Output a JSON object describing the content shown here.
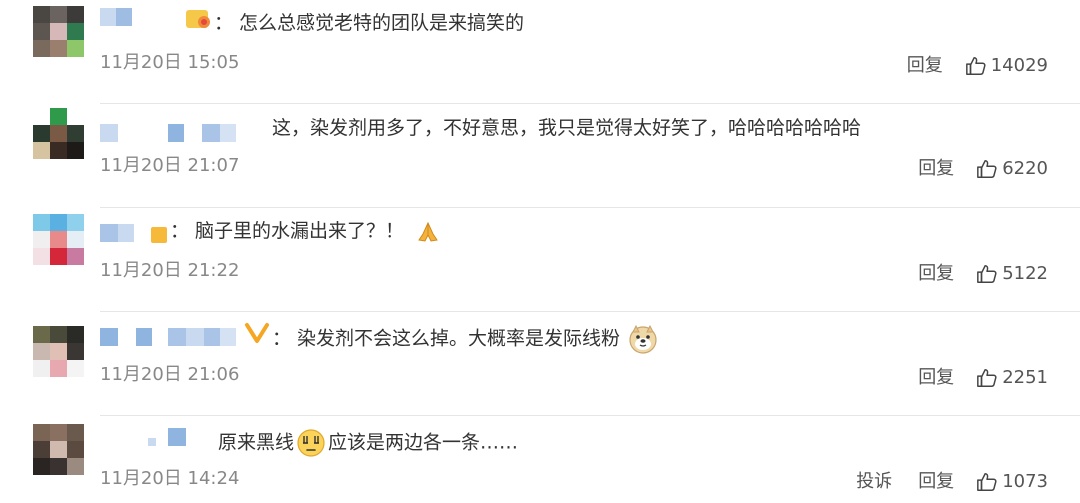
{
  "comments": [
    {
      "text": "：  怎么总感觉老特的团队是来搞笑的",
      "time": "11月20日 15:05",
      "reply_label": "回复",
      "likes": "14029",
      "report_label": ""
    },
    {
      "text": "这，染发剂用多了，不好意思，我只是觉得太好笑了，哈哈哈哈哈哈哈",
      "time": "11月20日 21:07",
      "reply_label": "回复",
      "likes": "6220",
      "report_label": ""
    },
    {
      "text": "：  脑子里的水漏出来了？！",
      "time": "11月20日 21:22",
      "reply_label": "回复",
      "likes": "5122",
      "report_label": ""
    },
    {
      "text": "：  染发剂不会这么掉。大概率是发际线粉",
      "time": "11月20日 21:06",
      "reply_label": "回复",
      "likes": "2251",
      "report_label": ""
    },
    {
      "text_before": "原来黑线",
      "text_after": "应该是两边各一条……",
      "time": "11月20日 14:24",
      "reply_label": "回复",
      "likes": "1073",
      "report_label": "投诉"
    }
  ],
  "colors": {
    "time": "#888888",
    "text": "#333333",
    "blur_blue": "#8fb4e0",
    "divider": "#e6e6e6"
  },
  "icons": [
    "thumbs-up-icon",
    "fire-badge-icon",
    "vip-v-badge-icon",
    "pray-emoji-icon",
    "doge-emoji-icon",
    "speechless-emoji-icon"
  ]
}
